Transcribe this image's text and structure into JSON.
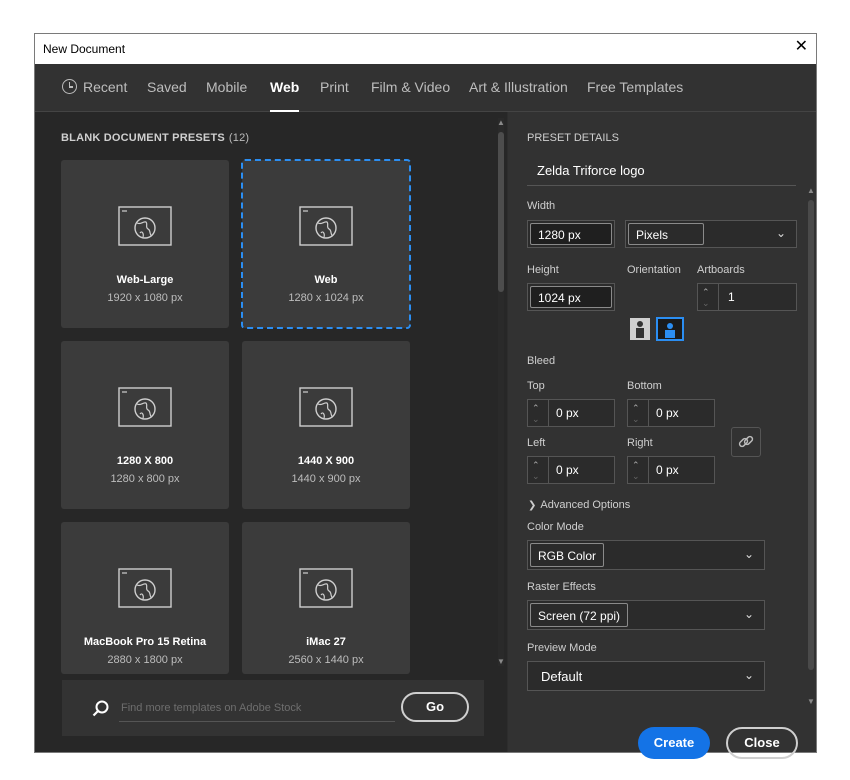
{
  "window": {
    "title": "New Document",
    "close_symbol": "✕"
  },
  "tabs": [
    {
      "label": "Recent",
      "active": false,
      "icon": "clock-icon"
    },
    {
      "label": "Saved",
      "active": false
    },
    {
      "label": "Mobile",
      "active": false
    },
    {
      "label": "Web",
      "active": true
    },
    {
      "label": "Print",
      "active": false
    },
    {
      "label": "Film & Video",
      "active": false
    },
    {
      "label": "Art & Illustration",
      "active": false
    },
    {
      "label": "Free Templates",
      "active": false
    }
  ],
  "presets": {
    "heading": "BLANK DOCUMENT PRESETS",
    "count": "(12)",
    "items": [
      {
        "name": "Web-Large",
        "size": "1920 x 1080 px",
        "selected": false,
        "icon": "web-preset-icon"
      },
      {
        "name": "Web",
        "size": "1280 x 1024 px",
        "selected": true,
        "icon": "web-preset-icon"
      },
      {
        "name": "1280 X 800",
        "size": "1280 x 800 px",
        "selected": false,
        "icon": "web-preset-icon"
      },
      {
        "name": "1440 X 900",
        "size": "1440 x 900 px",
        "selected": false,
        "icon": "web-preset-icon"
      },
      {
        "name": "MacBook Pro 15 Retina",
        "size": "2880 x 1800 px",
        "selected": false,
        "icon": "web-preset-icon"
      },
      {
        "name": "iMac 27",
        "size": "2560 x 1440 px",
        "selected": false,
        "icon": "web-preset-icon"
      }
    ]
  },
  "search": {
    "placeholder": "Find more templates on Adobe Stock",
    "go_label": "Go",
    "icon": "search-icon"
  },
  "details": {
    "heading": "PRESET DETAILS",
    "name": "Zelda Triforce logo",
    "width_label": "Width",
    "width_value": "1280 px",
    "unit_value": "Pixels",
    "height_label": "Height",
    "height_value": "1024 px",
    "orientation_label": "Orientation",
    "artboards_label": "Artboards",
    "artboards_value": "1",
    "bleed_label": "Bleed",
    "top_label": "Top",
    "top_value": "0 px",
    "bottom_label": "Bottom",
    "bottom_value": "0 px",
    "left_label": "Left",
    "left_value": "0 px",
    "right_label": "Right",
    "right_value": "0 px",
    "advanced_label": "Advanced Options",
    "color_mode_label": "Color Mode",
    "color_mode_value": "RGB Color",
    "raster_label": "Raster Effects",
    "raster_value": "Screen (72 ppi)",
    "preview_label": "Preview Mode",
    "preview_value": "Default"
  },
  "buttons": {
    "create": "Create",
    "close": "Close"
  },
  "colors": {
    "accent": "#1473e6",
    "selection": "#2b8ef2",
    "panel": "#323232",
    "left_panel": "#272727",
    "card": "#3b3b3b"
  }
}
